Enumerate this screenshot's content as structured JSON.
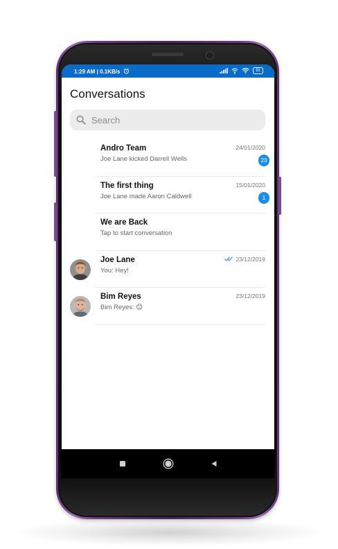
{
  "status_bar": {
    "time_speed": "1:29 AM | 0.1KB/s",
    "battery": "91"
  },
  "header": {
    "title": "Conversations"
  },
  "search": {
    "placeholder": "Search"
  },
  "conversations": [
    {
      "name": "Andro Team",
      "preview": "Joe Lane kicked Darrell Wells",
      "date": "24/01/2020",
      "unread": "23"
    },
    {
      "name": "The first thing",
      "preview": "Joe Lane made Aaron Caldwell",
      "date": "15/01/2020",
      "unread": "1"
    },
    {
      "name": "We are Back",
      "preview": "Tap to start conversation"
    },
    {
      "name": "Joe Lane",
      "preview": "You: Hey!",
      "date": "23/12/2019",
      "read_receipt": "double-check-icon"
    },
    {
      "name": "Bim Reyes",
      "preview": "Bim Reyes: 😊",
      "date": "23/12/2019"
    }
  ],
  "colors": {
    "accent": "#1a8fe8",
    "status_bar": "#0a6bc9",
    "phone_frame": "#7b4a8f"
  },
  "nav_bar": {
    "icons": [
      "recent-apps-icon",
      "home-icon",
      "back-icon"
    ]
  }
}
